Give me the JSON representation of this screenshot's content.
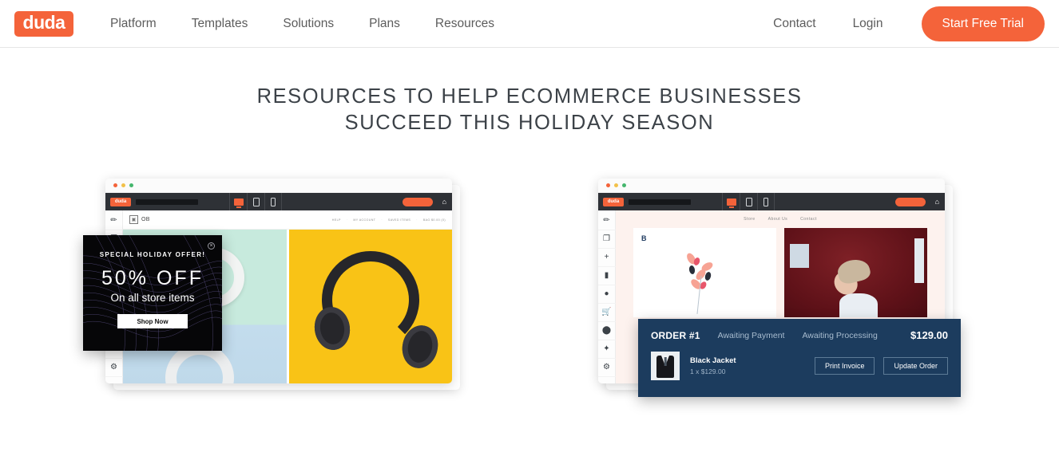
{
  "nav": {
    "logo_text": "duda",
    "brand_color": "#f4633a",
    "links": [
      {
        "label": "Platform"
      },
      {
        "label": "Templates"
      },
      {
        "label": "Solutions"
      },
      {
        "label": "Plans"
      },
      {
        "label": "Resources"
      }
    ],
    "right_links": [
      {
        "label": "Contact"
      },
      {
        "label": "Login"
      }
    ],
    "cta_label": "Start Free Trial"
  },
  "heading": {
    "line1": "Resources to help ecommerce businesses",
    "line2": "succeed this holiday season",
    "color": "#3c4248"
  },
  "left_mock": {
    "editor": {
      "logo_text": "duda",
      "devices": [
        "desktop-icon",
        "tablet-icon",
        "mobile-icon"
      ],
      "active_device": "desktop-icon",
      "home_icon": "⌂"
    },
    "rail_icons": [
      "pen-icon",
      "layers-icon",
      "plus-icon",
      "folder-icon",
      "person-icon",
      "cart-icon",
      "blob-icon",
      "puzzle-icon",
      "gear-icon"
    ],
    "store": {
      "brand": "OB",
      "nav": [
        "HELP",
        "MY ACCOUNT",
        "SAVED ITEMS",
        "BAG $0.00 (0)"
      ],
      "separator": "·"
    },
    "promo": {
      "kicker": "SPECIAL HOLIDAY OFFER!",
      "headline": "50% OFF",
      "subline": "On all store items",
      "button_label": "Shop Now",
      "close_icon": "×",
      "background": "#060608"
    }
  },
  "right_mock": {
    "editor": {
      "logo_text": "duda",
      "devices": [
        "desktop-icon",
        "tablet-icon",
        "mobile-icon"
      ],
      "active_device": "desktop-icon",
      "home_icon": "⌂"
    },
    "rail_icons": [
      "pen-icon",
      "layers-icon",
      "plus-icon",
      "folder-icon",
      "person-icon",
      "cart-icon",
      "blob-icon",
      "puzzle-icon",
      "gear-icon"
    ],
    "store": {
      "monogram": "B",
      "nav": [
        "Store",
        "About Us",
        "Contact"
      ]
    },
    "order": {
      "id": "ORDER #1",
      "status_payment": "Awaiting Payment",
      "status_processing": "Awaiting Processing",
      "total": "$129.00",
      "item_name": "Black Jacket",
      "item_qty": "1 x $129.00",
      "print_label": "Print Invoice",
      "update_label": "Update Order",
      "background": "#1c3c5e"
    }
  }
}
